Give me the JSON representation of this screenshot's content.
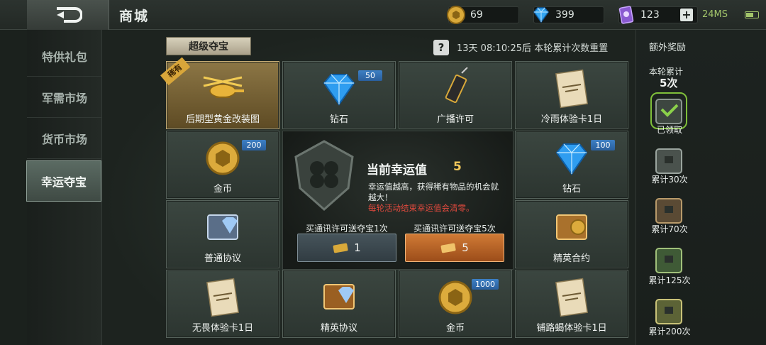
{
  "header": {
    "title": "商城",
    "gold": "69",
    "diamond": "399",
    "ticket": "123",
    "plus": "+",
    "ping": "24MS"
  },
  "sidebar": {
    "items": [
      {
        "label": "特供礼包"
      },
      {
        "label": "军需市场"
      },
      {
        "label": "货币市场"
      },
      {
        "label": "幸运夺宝"
      }
    ]
  },
  "main": {
    "tab_title": "超级夺宝",
    "help": "?",
    "reset_text": "13天 08:10:25后 本轮累计次数重置",
    "rare_tag": "稀有",
    "cells": [
      {
        "label": "后期型黄金改装图",
        "badge": ""
      },
      {
        "label": "钻石",
        "badge": "50"
      },
      {
        "label": "广播许可",
        "badge": ""
      },
      {
        "label": "冷雨体验卡1日",
        "badge": ""
      },
      {
        "label": "金币",
        "badge": "200"
      },
      {
        "label": "钻石",
        "badge": "100"
      },
      {
        "label": "普通协议",
        "badge": ""
      },
      {
        "label": "精英合约",
        "badge": ""
      },
      {
        "label": "无畏体验卡1日",
        "badge": ""
      },
      {
        "label": "精英协议",
        "badge": ""
      },
      {
        "label": "金币",
        "badge": "1000"
      },
      {
        "label": "铺路蝎体验卡1日",
        "badge": ""
      }
    ],
    "lucky": {
      "title": "当前幸运值",
      "value": "5",
      "desc": "幸运值越高，获得稀有物品的机会就越大！",
      "warn": "每轮活动结束幸运值会清零。",
      "buy1_label": "买通讯许可送夺宝1次",
      "buy1_value": "1",
      "buy5_label": "买通讯许可送夺宝5次",
      "buy5_value": "5"
    }
  },
  "right": {
    "title": "额外奖励",
    "cum_label": "本轮累计",
    "cum_value": "5次",
    "rewards": [
      {
        "label": "已领取"
      },
      {
        "label": "累计30次"
      },
      {
        "label": "累计70次"
      },
      {
        "label": "累计125次"
      },
      {
        "label": "累计200次"
      }
    ]
  }
}
